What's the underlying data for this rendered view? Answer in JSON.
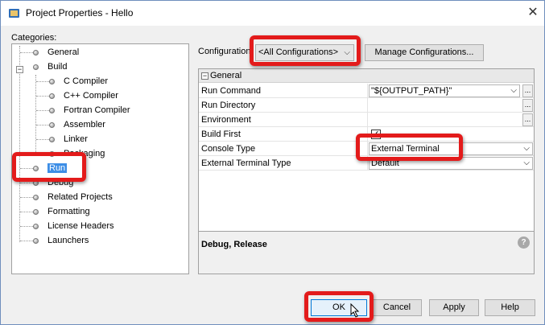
{
  "window": {
    "title": "Project Properties - Hello",
    "close_glyph": "✕"
  },
  "categories": {
    "label": "Categories:",
    "items": [
      {
        "label": "General"
      },
      {
        "label": "Build"
      },
      {
        "label": "C Compiler"
      },
      {
        "label": "C++ Compiler"
      },
      {
        "label": "Fortran Compiler"
      },
      {
        "label": "Assembler"
      },
      {
        "label": "Linker"
      },
      {
        "label": "Packaging"
      },
      {
        "label": "Run",
        "selected": true
      },
      {
        "label": "Debug"
      },
      {
        "label": "Related Projects"
      },
      {
        "label": "Formatting"
      },
      {
        "label": "License Headers"
      },
      {
        "label": "Launchers"
      }
    ]
  },
  "configuration": {
    "label": "Configuration:",
    "selected": "<All Configurations>",
    "manage_label": "Manage Configurations..."
  },
  "properties": {
    "group": "General",
    "rows": [
      {
        "name": "Run Command",
        "value": "\"${OUTPUT_PATH}\""
      },
      {
        "name": "Run Directory",
        "value": ""
      },
      {
        "name": "Environment",
        "value": ""
      },
      {
        "name": "Build First",
        "value": "checked"
      },
      {
        "name": "Console Type",
        "value": "External Terminal"
      },
      {
        "name": "External Terminal Type",
        "value": "Default"
      }
    ]
  },
  "description": {
    "text": "Debug, Release",
    "help_glyph": "?"
  },
  "buttons": {
    "ok": "OK",
    "cancel": "Cancel",
    "apply": "Apply",
    "help": "Help"
  },
  "icons": {
    "chevron": "⌵",
    "ellipsis": "...",
    "expander": "−",
    "check": "✓"
  },
  "colors": {
    "highlight": "#e31b1b",
    "selection": "#3d8ee6"
  }
}
